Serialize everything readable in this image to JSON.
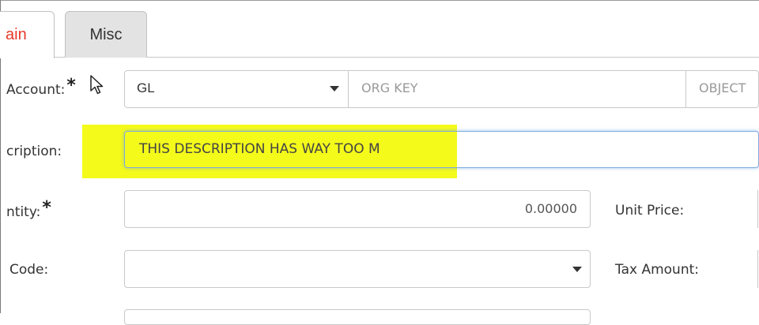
{
  "tabs": [
    {
      "label": "ain",
      "active": true
    },
    {
      "label": "Misc",
      "active": false
    }
  ],
  "form": {
    "account": {
      "label": "Account:",
      "required": "*",
      "type_value": "GL",
      "org_key_placeholder": "ORG KEY",
      "object_placeholder": "OBJECT"
    },
    "description": {
      "label": "cription:",
      "value": "THIS DESCRIPTION HAS WAY TOO M"
    },
    "quantity": {
      "label": "ntity:",
      "required": "*",
      "value": "0.00000"
    },
    "unit_price": {
      "label": "Unit Price:"
    },
    "code": {
      "label": "Code:"
    },
    "tax_amount": {
      "label": "Tax Amount:"
    }
  },
  "colors": {
    "active_tab_text": "#e8392b",
    "highlight": "#f4fa1a",
    "focus_border": "#7eaadf"
  }
}
